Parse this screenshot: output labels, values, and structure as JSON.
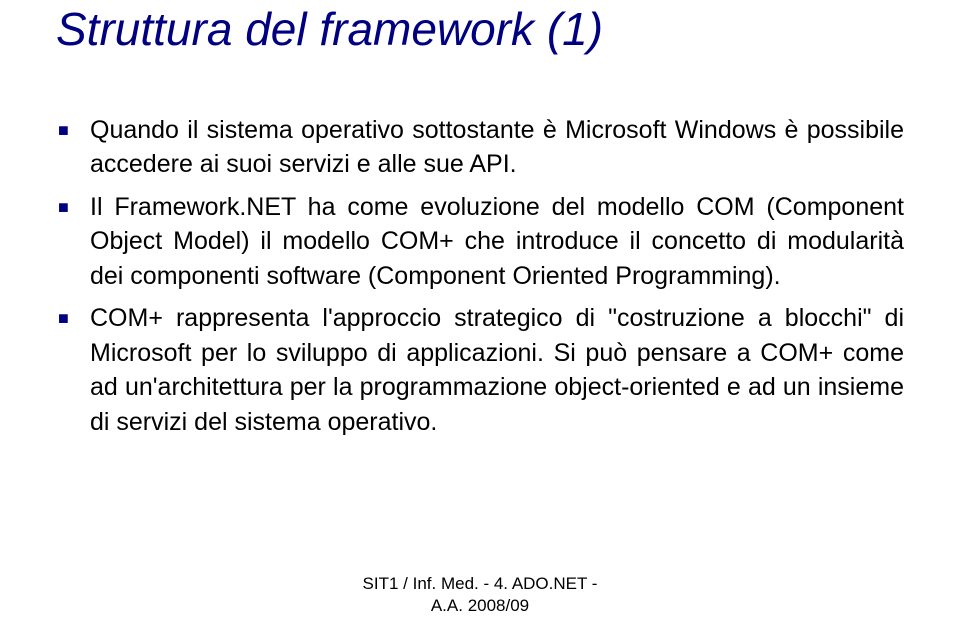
{
  "title": "Struttura del framework (1)",
  "bullets": [
    "Quando il sistema operativo sottostante è Microsoft Windows è possibile accedere ai suoi servizi e alle sue API.",
    "Il Framework.NET ha come evoluzione del modello COM (Component Object Model) il modello COM+ che introduce il concetto di modularità dei componenti software (Component Oriented Programming).",
    "COM+ rappresenta l'approccio strategico di \"costruzione a blocchi\" di Microsoft per lo sviluppo di applicazioni. Si può pensare a COM+ come ad un'architettura per la programmazione object-oriented e ad un insieme di servizi del sistema operativo."
  ],
  "footer": {
    "line1": "SIT1 / Inf. Med. - 4. ADO.NET -",
    "line2": "A.A. 2008/09"
  }
}
